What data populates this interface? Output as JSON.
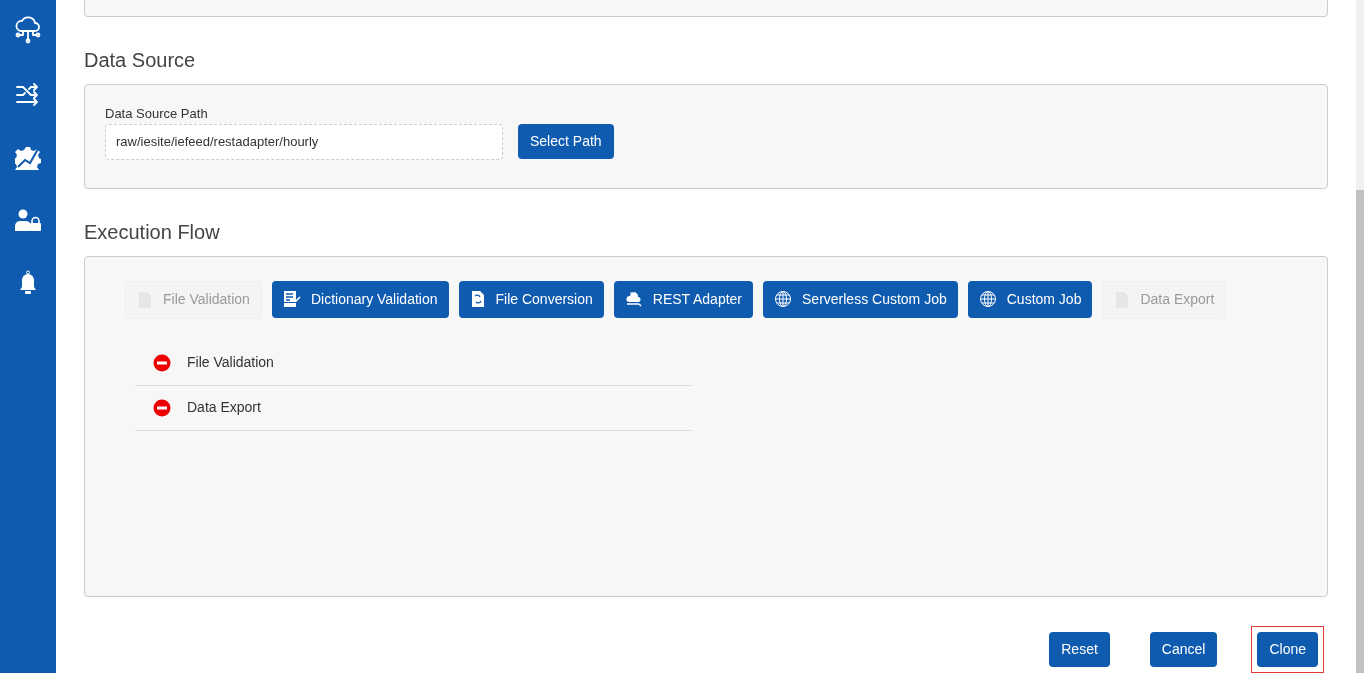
{
  "sidebar": {
    "items": [
      {
        "kind": "cloud"
      },
      {
        "kind": "shuffle"
      },
      {
        "kind": "gear"
      },
      {
        "kind": "user-lock"
      },
      {
        "kind": "bell"
      }
    ]
  },
  "data_source": {
    "heading": "Data Source",
    "label": "Data Source Path",
    "value": "raw/iesite/iefeed/restadapter/hourly",
    "button": "Select Path"
  },
  "execution_flow": {
    "heading": "Execution Flow",
    "steps": [
      {
        "label": "File Validation",
        "kind": "document",
        "disabled": true
      },
      {
        "label": "Dictionary Validation",
        "kind": "dictionary",
        "disabled": false
      },
      {
        "label": "File Conversion",
        "kind": "conversion",
        "disabled": false
      },
      {
        "label": "REST Adapter",
        "kind": "rest",
        "disabled": false
      },
      {
        "label": "Serverless Custom Job",
        "kind": "globe",
        "disabled": false
      },
      {
        "label": "Custom Job",
        "kind": "globe",
        "disabled": false
      },
      {
        "label": "Data Export",
        "kind": "document",
        "disabled": true
      }
    ],
    "removed": [
      {
        "label": "File Validation"
      },
      {
        "label": "Data Export"
      }
    ]
  },
  "actions": [
    {
      "label": "Reset",
      "highlighted": false
    },
    {
      "label": "Cancel",
      "highlighted": false
    },
    {
      "label": "Clone",
      "highlighted": true
    }
  ]
}
